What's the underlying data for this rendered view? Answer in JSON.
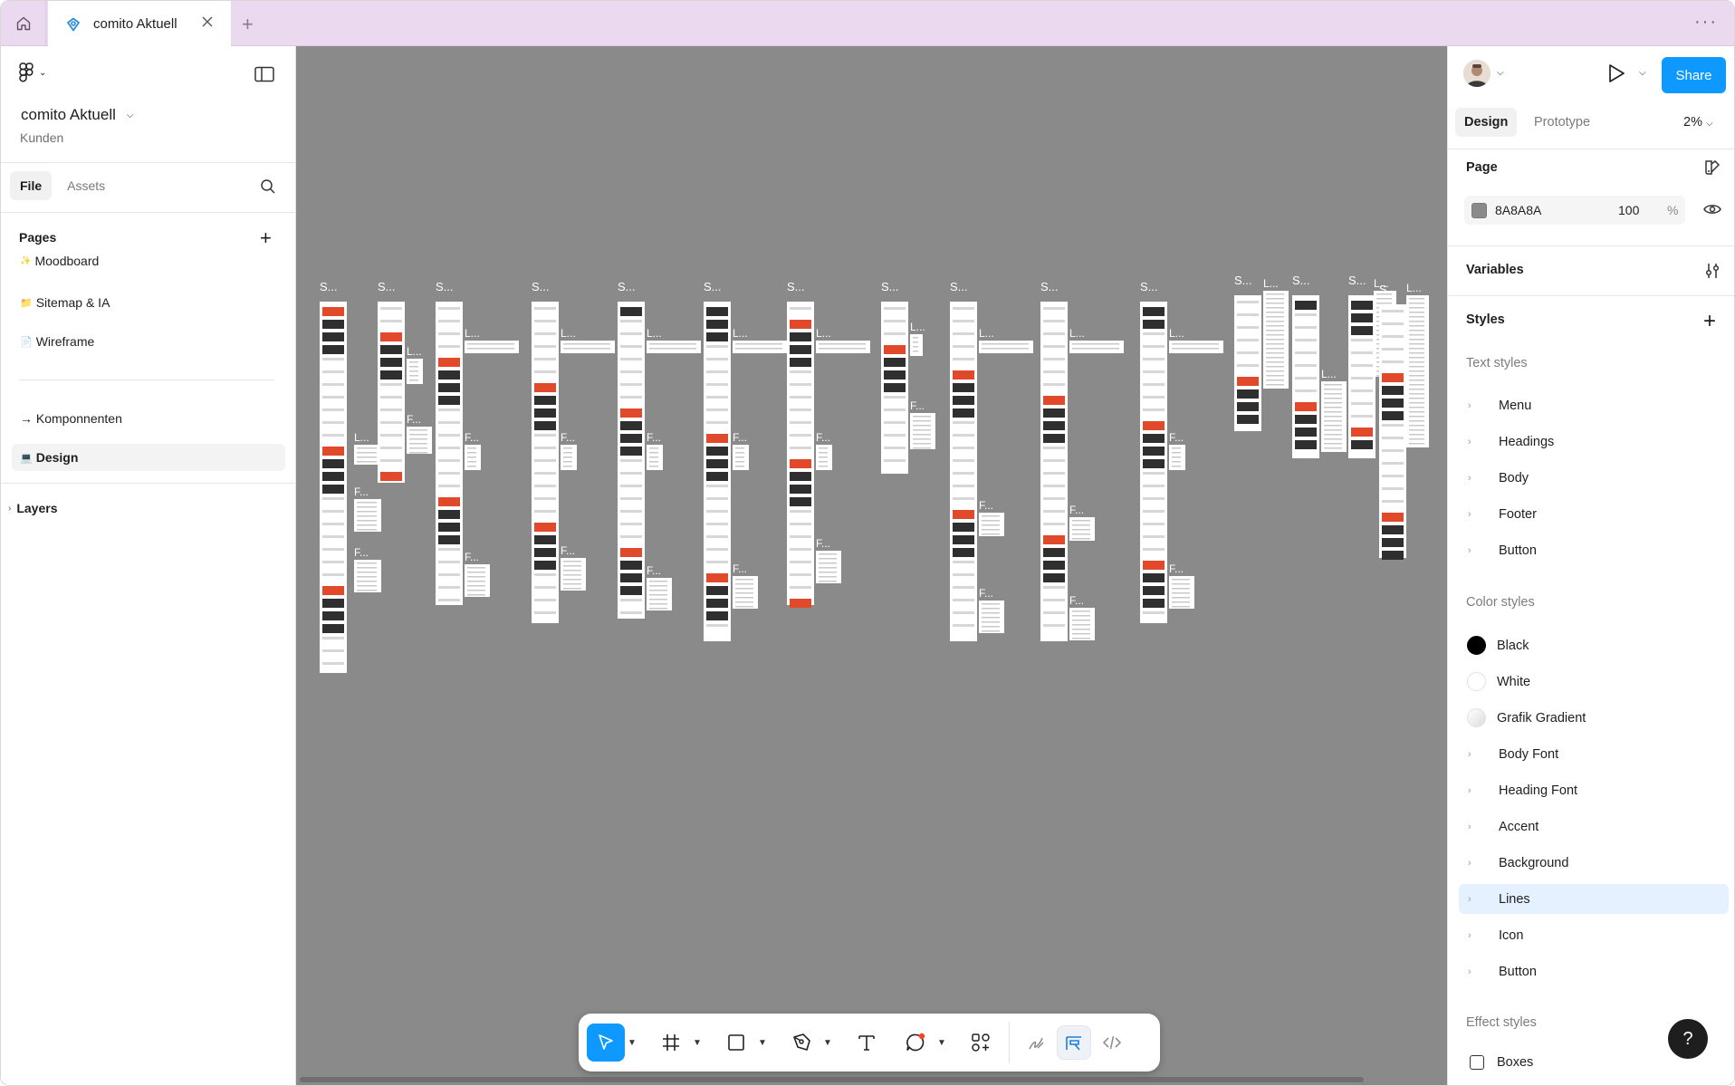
{
  "tabbar": {
    "tab_title": "comito Aktuell",
    "icons": [
      "home-icon",
      "figma-file-icon",
      "close-icon",
      "plus-icon",
      "more-icon"
    ]
  },
  "left": {
    "file_title": "comito Aktuell",
    "team": "Kunden",
    "tabs": [
      {
        "label": "File"
      },
      {
        "label": "Assets"
      }
    ],
    "pages_heading": "Pages",
    "pages": [
      {
        "emoji": "✨",
        "label": "Moodboard"
      },
      {
        "emoji": "📁",
        "label": "Sitemap & IA"
      },
      {
        "emoji": "📄",
        "label": "Wireframe"
      },
      {
        "emoji": "",
        "label": "→ Komponnenten"
      },
      {
        "emoji": "💻",
        "label": "Design"
      }
    ],
    "layers_label": "Layers"
  },
  "canvas": {
    "background": "#8A8A8A",
    "frame_label_samples": [
      "S...",
      "F...",
      "L...",
      "/..."
    ]
  },
  "toolbar": {
    "tools": [
      "move-tool",
      "frame-tool",
      "rectangle-tool",
      "pen-tool",
      "text-tool",
      "comment-tool",
      "actions-tool",
      "draw-tool",
      "design-mode-tool",
      "dev-mode-tool"
    ]
  },
  "right": {
    "share_label": "Share",
    "tabs": [
      {
        "label": "Design"
      },
      {
        "label": "Prototype"
      }
    ],
    "zoom": "2%",
    "page_heading": "Page",
    "page_color_hex": "8A8A8A",
    "page_opacity": "100",
    "page_opacity_unit": "%",
    "variables_heading": "Variables",
    "styles_heading": "Styles",
    "text_styles_heading": "Text styles",
    "text_styles": [
      "Menu",
      "Headings",
      "Body",
      "Footer",
      "Button"
    ],
    "color_styles_heading": "Color styles",
    "color_swatches": [
      {
        "label": "Black",
        "color": "#000000"
      },
      {
        "label": "White",
        "color": "#FFFFFF"
      },
      {
        "label": "Grafik Gradient",
        "color": "#EFEFEF"
      }
    ],
    "color_groups": [
      "Body Font",
      "Heading Font",
      "Accent",
      "Background",
      "Lines",
      "Icon",
      "Button"
    ],
    "highlighted_group": "Lines",
    "effect_styles_heading": "Effect styles",
    "effect_styles": [
      "Boxes"
    ],
    "help_label": "?"
  }
}
